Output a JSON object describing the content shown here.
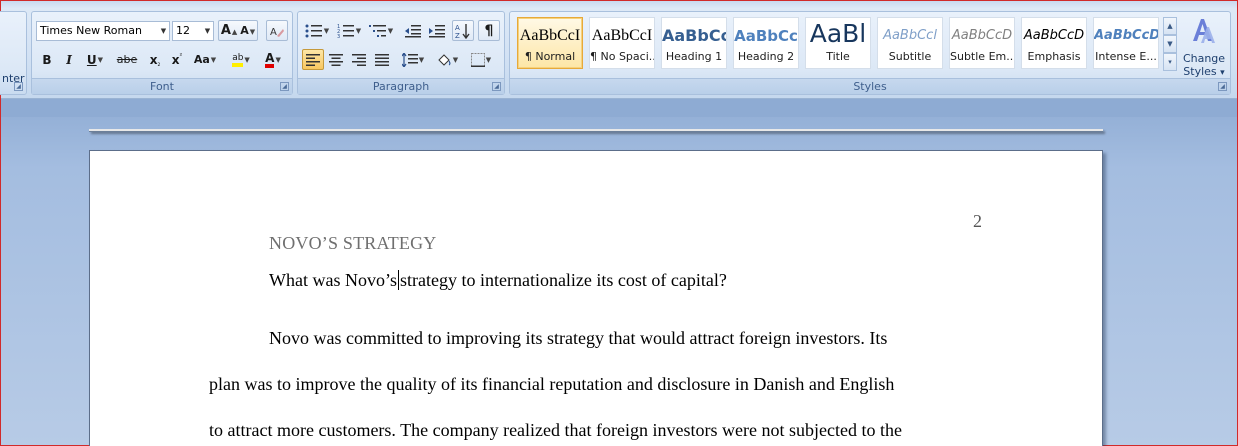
{
  "clipboard": {
    "partial_label": "nter"
  },
  "font_group": {
    "label": "Font",
    "font_name": "Times New Roman",
    "font_size": "12",
    "grow_font": "A",
    "shrink_font": "A",
    "bold": "B",
    "italic": "I",
    "underline": "U",
    "strikethrough": "abe",
    "subscript": "x",
    "superscript": "x",
    "change_case": "Aa",
    "highlight": "ab",
    "font_color": "A"
  },
  "paragraph_group": {
    "label": "Paragraph",
    "show_marks": "¶"
  },
  "styles_group": {
    "label": "Styles",
    "items": [
      {
        "sample": "AaBbCcI",
        "name": "¶ Normal",
        "selected": true
      },
      {
        "sample": "AaBbCcI",
        "name": "¶ No Spaci..."
      },
      {
        "sample": "AaBbCc",
        "name": "Heading 1"
      },
      {
        "sample": "AaBbCc",
        "name": "Heading 2"
      },
      {
        "sample": "AaBl",
        "name": "Title"
      },
      {
        "sample": "AaBbCcl",
        "name": "Subtitle"
      },
      {
        "sample": "AaBbCcD",
        "name": "Subtle Em..."
      },
      {
        "sample": "AaBbCcD",
        "name": "Emphasis"
      },
      {
        "sample": "AaBbCcD",
        "name": "Intense E..."
      }
    ],
    "change_styles_line1": "Change",
    "change_styles_line2": "Styles",
    "change_styles_arrow": "▾"
  },
  "document": {
    "page_number": "2",
    "heading": "NOVO’S STRATEGY",
    "question_before_caret": "What was Novo’s",
    "question_after_caret": "strategy to internationalize its cost of capital?",
    "body_lines": [
      "Novo was committed to improving its strategy that would attract foreign investors. Its",
      "plan was to improve the quality of its financial reputation and disclosure in Danish and English",
      "to attract more customers. The company realized that foreign investors were not subjected to the"
    ]
  }
}
